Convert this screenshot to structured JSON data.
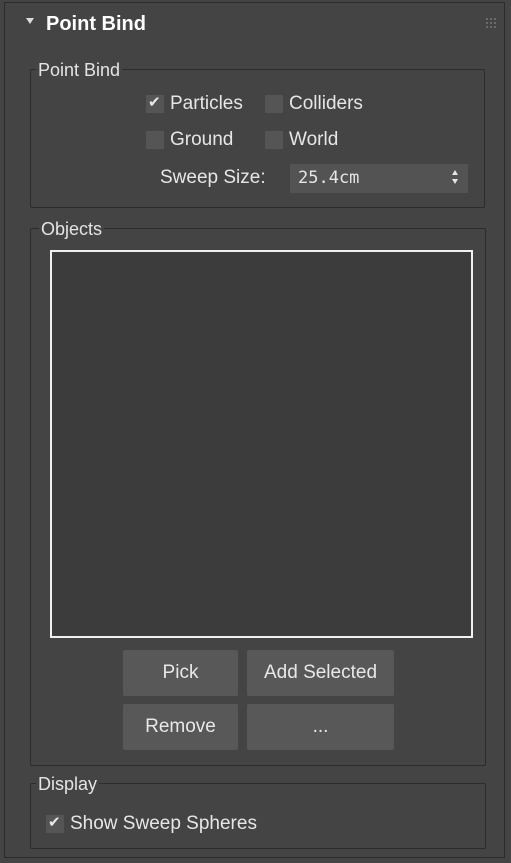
{
  "rollout": {
    "title": "Point Bind"
  },
  "point_bind_group": {
    "label": "Point Bind",
    "checkboxes": [
      {
        "label": "Particles",
        "checked": true
      },
      {
        "label": "Colliders",
        "checked": false
      },
      {
        "label": "Ground",
        "checked": false
      },
      {
        "label": "World",
        "checked": false
      }
    ],
    "sweep_size": {
      "label": "Sweep Size:",
      "value": "25.4cm"
    }
  },
  "objects_group": {
    "label": "Objects",
    "buttons": {
      "pick": "Pick",
      "add_selected": "Add Selected",
      "remove": "Remove",
      "more": "..."
    }
  },
  "display_group": {
    "label": "Display",
    "show_sweep_spheres": {
      "label": "Show Sweep Spheres",
      "checked": true
    }
  },
  "colors": {
    "panel_bg": "#444444",
    "control_bg": "#585858",
    "listbox_border": "#f0f0f0"
  }
}
